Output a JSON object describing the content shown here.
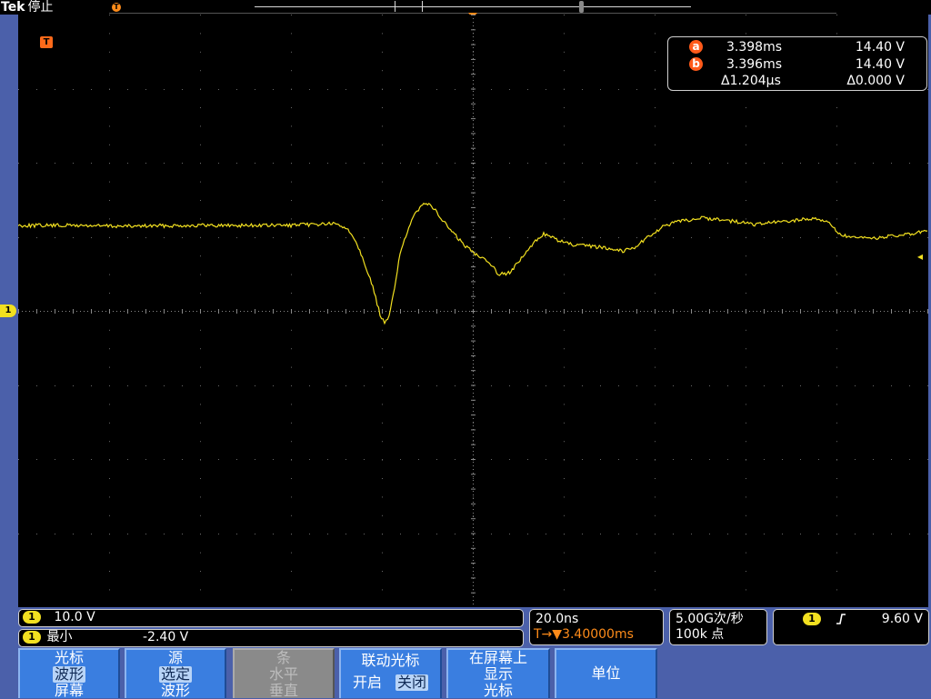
{
  "top": {
    "brand": "Tek",
    "state": "停止",
    "trigger_position_icon": "T"
  },
  "graticule": {
    "trigger_icon": "T",
    "ch1_ground_marker": "1",
    "trigger_level_icon": "left-arrow-icon"
  },
  "cursor_readout": {
    "a": {
      "badge": "a",
      "time": "3.398ms",
      "volt": "14.40 V"
    },
    "b": {
      "badge": "b",
      "time": "3.396ms",
      "volt": "14.40 V"
    },
    "delta": {
      "time": "Δ1.204μs",
      "volt": "Δ0.000 V"
    }
  },
  "status": {
    "ch1_scale": {
      "channel": "1",
      "value": "10.0 V"
    },
    "ch1_min": {
      "channel": "1",
      "label": "最小",
      "value": "-2.40 V"
    },
    "horizontal": {
      "scale": "20.0ns",
      "position_icon": "T→▼",
      "position": "3.40000ms"
    },
    "acquisition": {
      "rate": "5.00G次/秒",
      "record": "100k 点"
    },
    "trigger": {
      "channel": "1",
      "slope_icon": "rising-edge-icon",
      "level": "9.60 V"
    }
  },
  "softkeys": [
    {
      "title": "光标",
      "line2": "波形",
      "line3": "屏幕",
      "enabled": true
    },
    {
      "title": "源",
      "line2": "选定",
      "line3": "波形",
      "enabled": true
    },
    {
      "title": "条",
      "line2": "水平",
      "line3": "垂直",
      "enabled": false
    },
    {
      "title": "联动光标",
      "opt_on": "开启",
      "opt_off": "关闭",
      "enabled": true
    },
    {
      "title": "在屏幕上",
      "line2": "显示",
      "line3": "光标",
      "enabled": true
    },
    {
      "title": "单位",
      "enabled": true
    }
  ],
  "colors": {
    "ch1": "#f2e020",
    "trigger": "#ff8c1a",
    "cursor_badge": "#ff5a1a",
    "bezel": "#4b60aa",
    "softkey": "#3a7ee0"
  }
}
